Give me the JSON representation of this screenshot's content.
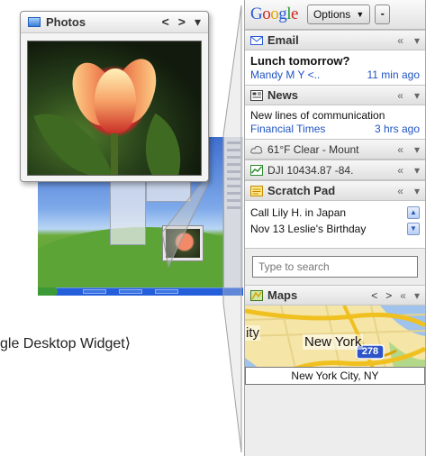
{
  "caption": "gle Desktop Widget⟩",
  "photos": {
    "title": "Photos",
    "nav": [
      "<",
      ">",
      "▾"
    ]
  },
  "sidebar": {
    "logo": [
      "G",
      "o",
      "o",
      "g",
      "l",
      "e"
    ],
    "options_label": "Options",
    "minimize_label": "-",
    "email": {
      "title": "Email",
      "subject": "Lunch tomorrow?",
      "from": "Mandy M Y <..",
      "time": "11 min ago"
    },
    "news": {
      "title": "News",
      "headline": "New lines of communication",
      "source": "Financial Times",
      "time": "3 hrs ago"
    },
    "weather": {
      "text": "61°F Clear - Mount"
    },
    "stocks": {
      "text": "DJI 10434.87 -84."
    },
    "scratch": {
      "title": "Scratch Pad",
      "lines": [
        "Call Lily H. in Japan",
        "Nov 13 Leslie's Birthday"
      ]
    },
    "search": {
      "placeholder": "Type to search"
    },
    "maps": {
      "title": "Maps",
      "city_partial": "ity",
      "city_label": "New York",
      "shield": "278",
      "location": "New York City, NY"
    },
    "collapse_glyph": "«",
    "menu_glyph": "▾"
  },
  "colors": {
    "link_blue": "#1f53c2",
    "header_bg": "#e2e2e2"
  }
}
